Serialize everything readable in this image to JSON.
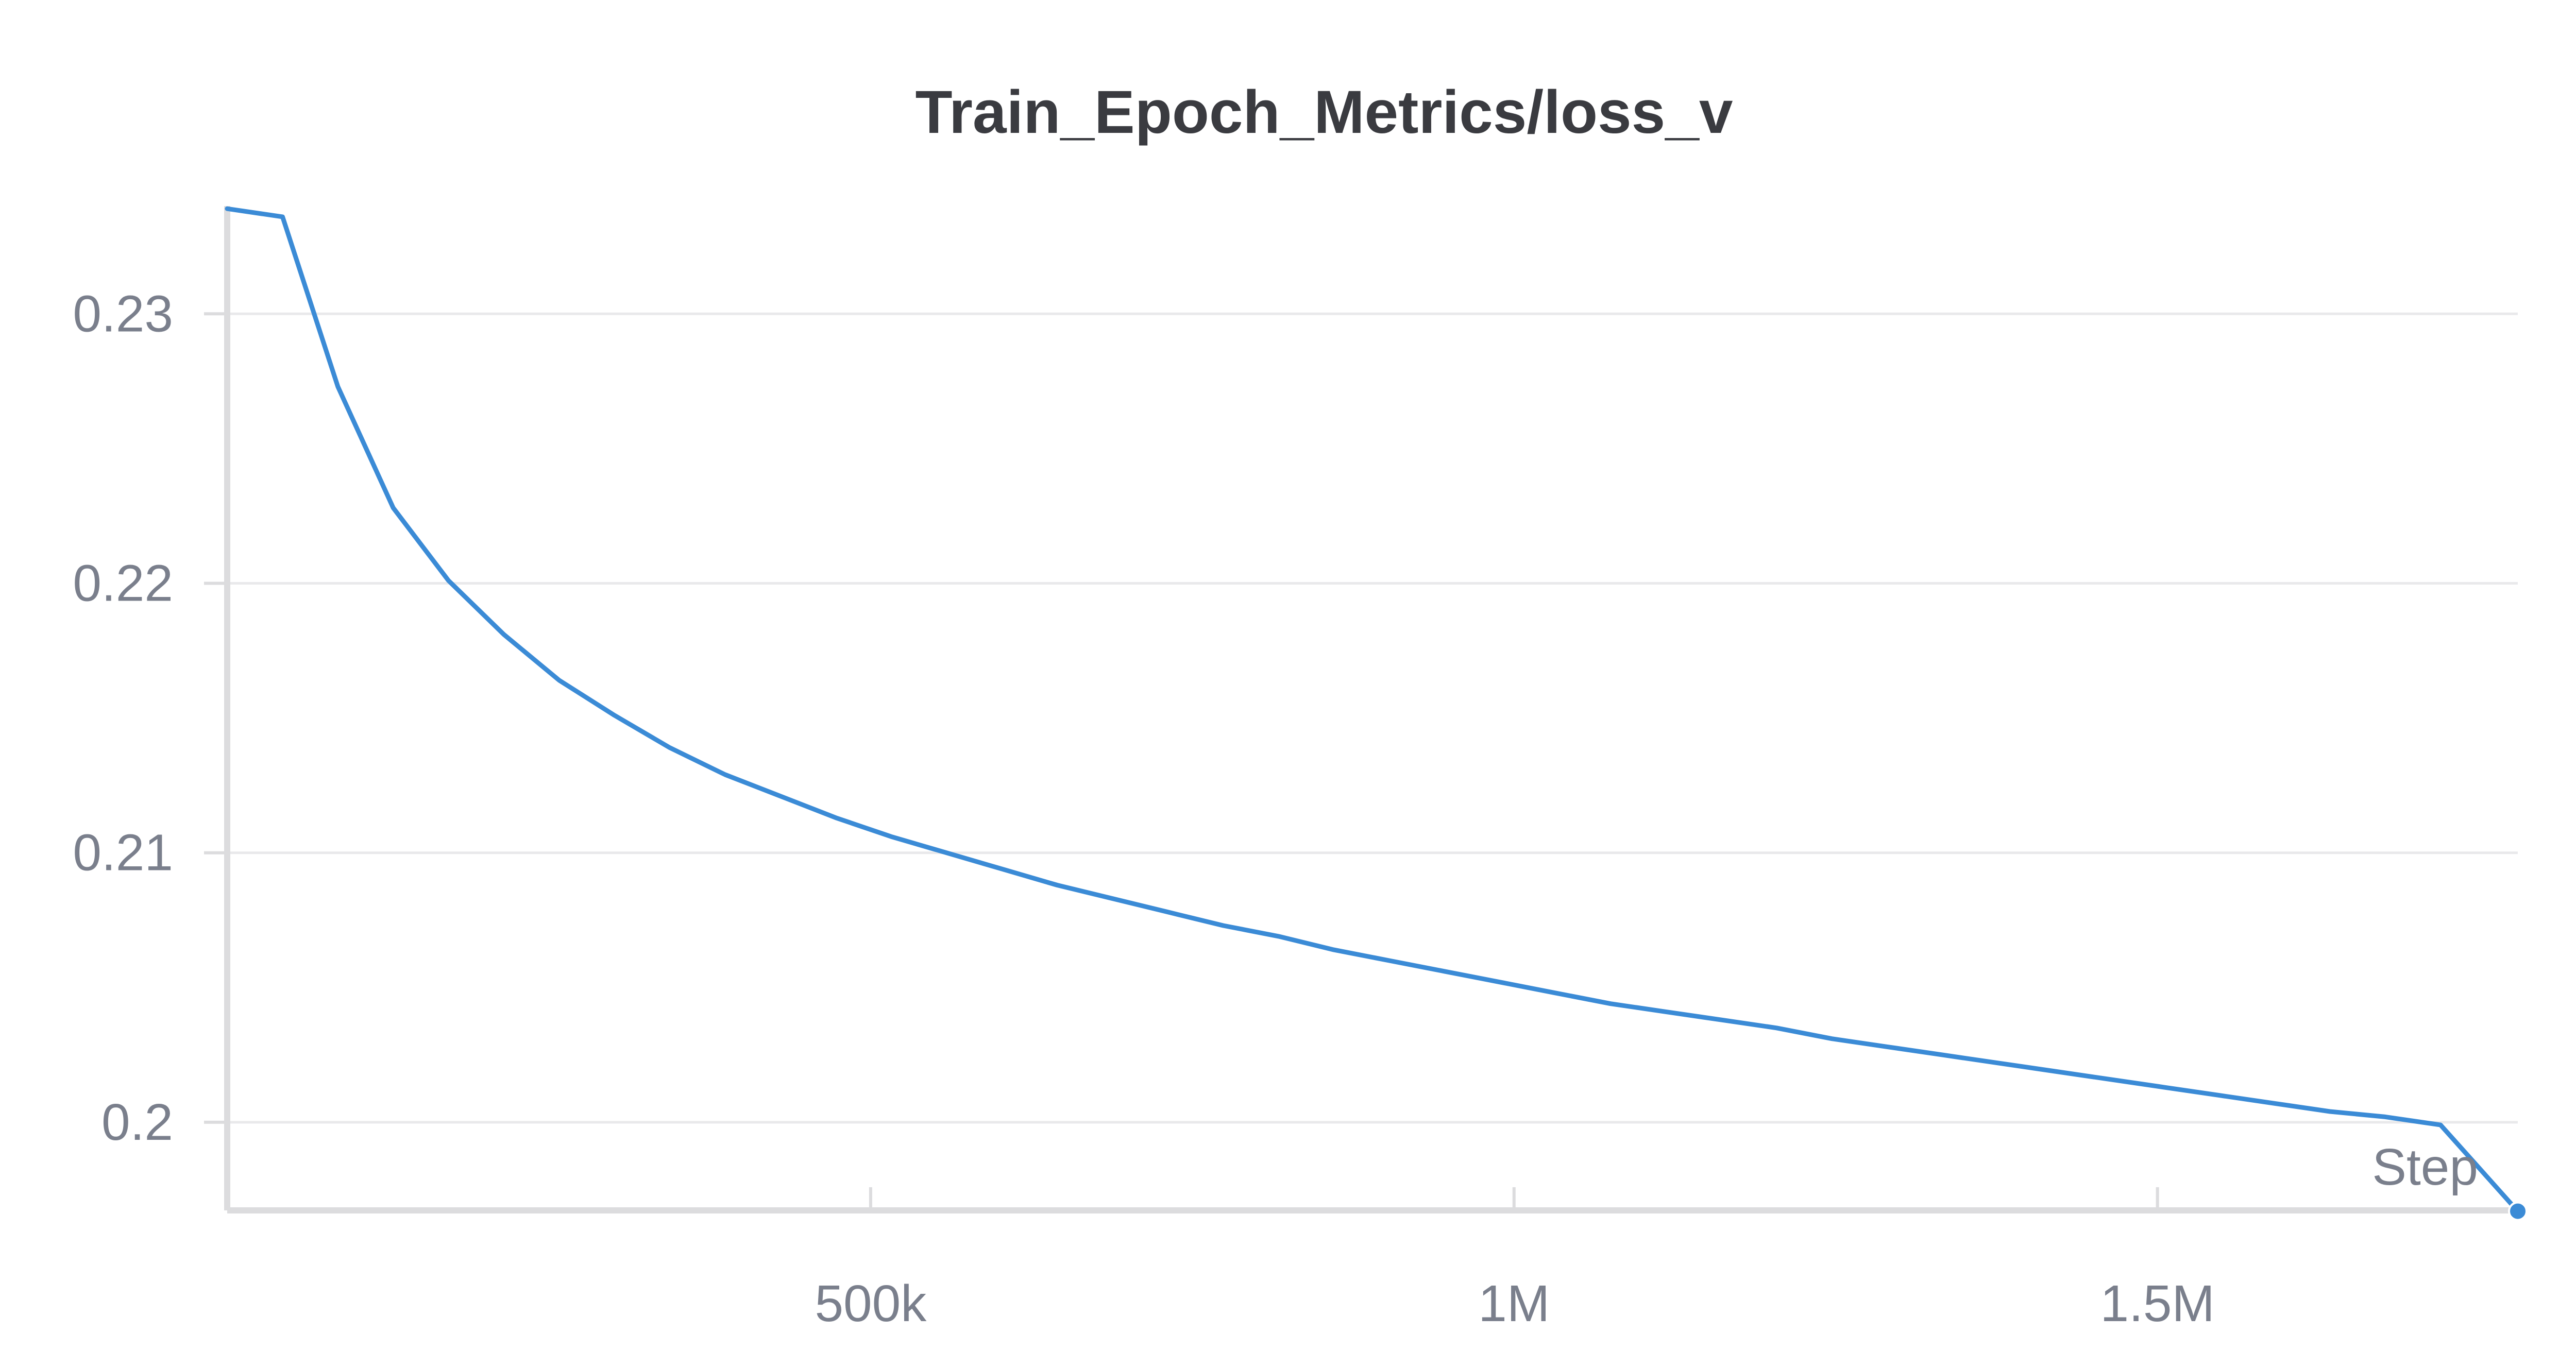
{
  "colors": {
    "line": "#3b8bd6",
    "grid": "#e9e9eb",
    "axis": "#dcdcde",
    "text": "#7a7f8c",
    "title": "#3a3b40"
  },
  "chart_data": {
    "type": "line",
    "title": "Train_Epoch_Metrics/loss_v",
    "xlabel": "Step",
    "ylabel": "",
    "xlim": [
      0,
      1780000
    ],
    "ylim": [
      0.19673,
      0.234
    ],
    "x_ticks": [
      {
        "value": 500000,
        "label": "500k"
      },
      {
        "value": 1000000,
        "label": "1M"
      },
      {
        "value": 1500000,
        "label": "1.5M"
      }
    ],
    "y_ticks": [
      {
        "value": 0.2,
        "label": "0.2"
      },
      {
        "value": 0.21,
        "label": "0.21"
      },
      {
        "value": 0.22,
        "label": "0.22"
      },
      {
        "value": 0.23,
        "label": "0.23"
      }
    ],
    "grid": true,
    "series": [
      {
        "x": [
          0,
          43000,
          86000,
          129000,
          172000,
          215000,
          258000,
          301000,
          344000,
          387000,
          430000,
          473000,
          516000,
          559000,
          602000,
          645000,
          688000,
          731000,
          774000,
          817000,
          860000,
          903000,
          946000,
          989000,
          1032000,
          1075000,
          1118000,
          1161000,
          1204000,
          1247000,
          1290000,
          1333000,
          1376000,
          1419000,
          1462000,
          1505000,
          1548000,
          1591000,
          1634000,
          1677000,
          1720000,
          1780000
        ],
        "y": [
          0.2339,
          0.2336,
          0.2273,
          0.2228,
          0.2201,
          0.2181,
          0.2164,
          0.2151,
          0.2139,
          0.2129,
          0.2121,
          0.2113,
          0.2106,
          0.21,
          0.2094,
          0.2088,
          0.2083,
          0.2078,
          0.2073,
          0.2069,
          0.2064,
          0.206,
          0.2056,
          0.2052,
          0.2048,
          0.2044,
          0.2041,
          0.2038,
          0.2035,
          0.2031,
          0.2028,
          0.2025,
          0.2022,
          0.2019,
          0.2016,
          0.2013,
          0.201,
          0.2007,
          0.2004,
          0.2002,
          0.1999,
          0.1967
        ]
      }
    ]
  }
}
